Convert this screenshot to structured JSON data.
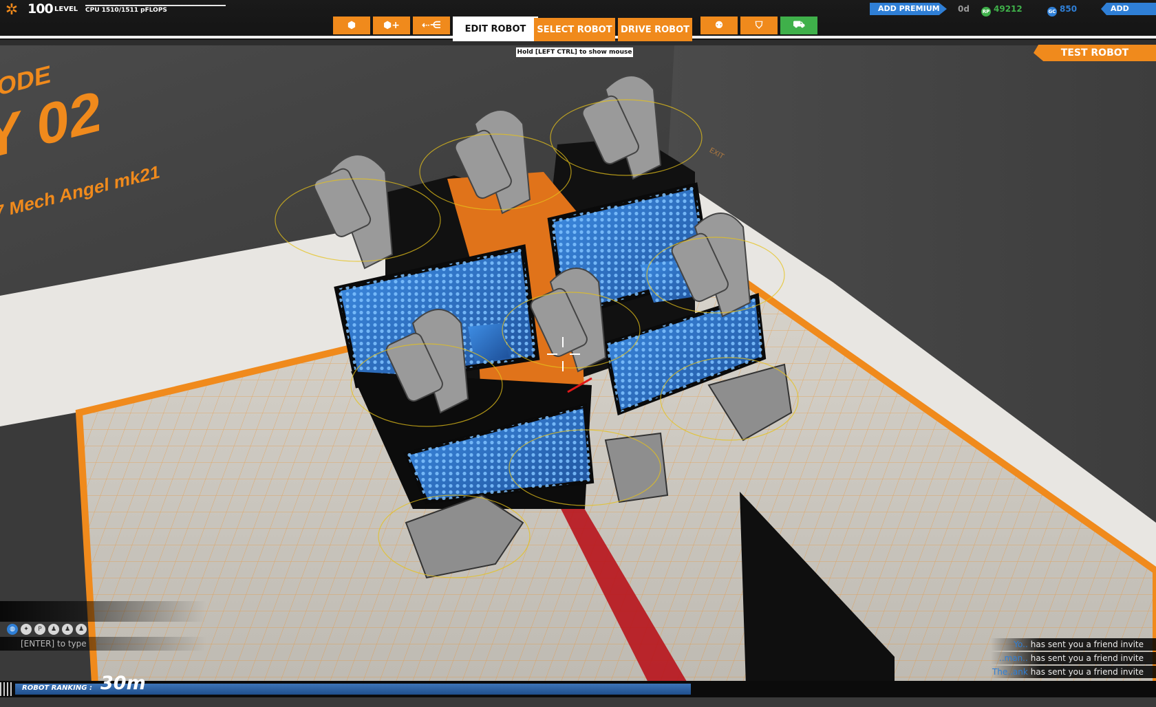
{
  "hud": {
    "level_number": "100",
    "level_label": "LEVEL",
    "cpu_text": "CPU 1510/1511 pFLOPS"
  },
  "toolbar": {
    "tabs": [
      {
        "label": "EDIT ROBOT",
        "active": true
      },
      {
        "label": "SELECT ROBOT",
        "active": false
      },
      {
        "label": "DRIVE ROBOT",
        "active": false
      }
    ],
    "hint": "Hold [LEFT CTRL] to show mouse"
  },
  "currency": {
    "add_premium": "ADD PREMIUM",
    "premium_days": "0d",
    "rp_icon": "RP",
    "robot_points": "49212",
    "gc_icon": "GC",
    "galaxy_coins": "850",
    "add_funds": "ADD FUNDS"
  },
  "test_robot_label": "TEST ROBOT",
  "bay_sign": {
    "line1": "ODE",
    "line2": "Y 02",
    "line3": "7 Mech Angel mk21"
  },
  "wall_sign": "EXIT",
  "chat": {
    "input_placeholder": "[ENTER] to type",
    "notifications": [
      {
        "who": "Yo..",
        "text": "has sent you a friend invite"
      },
      {
        "who": "..man..",
        "text": "has sent you a friend invite"
      },
      {
        "who": "The..ank",
        "text": "has sent you a friend invite"
      }
    ]
  },
  "ranking": {
    "label": "ROBOT RANKING :",
    "value": "30m"
  },
  "colors": {
    "accent_orange": "#f08a1c",
    "accent_blue": "#2f7fd6",
    "rp_green": "#3fb04a"
  }
}
